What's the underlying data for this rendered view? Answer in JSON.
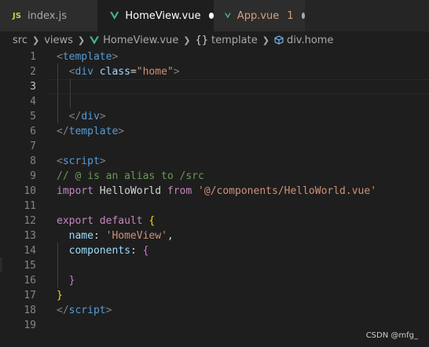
{
  "tabs": [
    {
      "name": "tab-index-js",
      "icon": "js-icon",
      "icon_text": "JS",
      "label": "index.js"
    },
    {
      "name": "tab-homeview-vue",
      "icon": "vue-icon",
      "label": "HomeView.vue",
      "dirty_color": "#ffffff"
    },
    {
      "name": "tab-app-vue",
      "icon": "vue-icon",
      "label": "App.vue",
      "problems": "1",
      "dirty_color": "#a9a9a9"
    }
  ],
  "breadcrumb": {
    "items": [
      "src",
      "views",
      "HomeView.vue",
      "template",
      "div.home"
    ],
    "braces_icon": "{}"
  },
  "colors": {
    "editor_bg": "#1e1e1e",
    "tab_bar_bg": "#252526",
    "vue_green": "#41b883",
    "tag": "#569cd6",
    "attr": "#9cdcfe",
    "string": "#ce9178",
    "comment": "#6a9955",
    "keyword": "#c586c0"
  },
  "active_line": 3,
  "lines": [
    {
      "num": "1",
      "tokens": [
        [
          "<",
          "punc"
        ],
        [
          "template",
          "tag"
        ],
        [
          ">",
          "punc"
        ]
      ]
    },
    {
      "num": "2",
      "tokens": [
        [
          "  ",
          "plain"
        ],
        [
          "<",
          "punc"
        ],
        [
          "div",
          "tag"
        ],
        [
          " ",
          "plain"
        ],
        [
          "class",
          "attr"
        ],
        [
          "=",
          "plain"
        ],
        [
          "\"home\"",
          "str"
        ],
        [
          ">",
          "punc"
        ]
      ]
    },
    {
      "num": "3",
      "tokens": []
    },
    {
      "num": "4",
      "tokens": []
    },
    {
      "num": "5",
      "tokens": [
        [
          "  ",
          "plain"
        ],
        [
          "</",
          "punc"
        ],
        [
          "div",
          "tag"
        ],
        [
          ">",
          "punc"
        ]
      ]
    },
    {
      "num": "6",
      "tokens": [
        [
          "</",
          "punc"
        ],
        [
          "template",
          "tag"
        ],
        [
          ">",
          "punc"
        ]
      ]
    },
    {
      "num": "7",
      "tokens": []
    },
    {
      "num": "8",
      "tokens": [
        [
          "<",
          "punc"
        ],
        [
          "script",
          "tag"
        ],
        [
          ">",
          "punc"
        ]
      ]
    },
    {
      "num": "9",
      "tokens": [
        [
          "// @ is an alias to /src",
          "comment"
        ]
      ]
    },
    {
      "num": "10",
      "tokens": [
        [
          "import",
          "kw"
        ],
        [
          " ",
          "plain"
        ],
        [
          "HelloWorld",
          "plain"
        ],
        [
          " ",
          "plain"
        ],
        [
          "from",
          "kw"
        ],
        [
          " ",
          "plain"
        ],
        [
          "'@/components/HelloWorld.vue'",
          "str"
        ]
      ]
    },
    {
      "num": "11",
      "tokens": []
    },
    {
      "num": "12",
      "tokens": [
        [
          "export",
          "kw"
        ],
        [
          " ",
          "plain"
        ],
        [
          "default",
          "kw"
        ],
        [
          " ",
          "plain"
        ],
        [
          "{",
          "brace1"
        ]
      ]
    },
    {
      "num": "13",
      "tokens": [
        [
          "  ",
          "plain"
        ],
        [
          "name",
          "var"
        ],
        [
          ": ",
          "plain"
        ],
        [
          "'HomeView'",
          "str"
        ],
        [
          ",",
          "plain"
        ]
      ]
    },
    {
      "num": "14",
      "tokens": [
        [
          "  ",
          "plain"
        ],
        [
          "components",
          "var"
        ],
        [
          ": ",
          "plain"
        ],
        [
          "{",
          "brace2"
        ]
      ]
    },
    {
      "num": "15",
      "tokens": []
    },
    {
      "num": "16",
      "tokens": [
        [
          "  ",
          "plain"
        ],
        [
          "}",
          "brace2"
        ]
      ]
    },
    {
      "num": "17",
      "tokens": [
        [
          "}",
          "brace1"
        ]
      ]
    },
    {
      "num": "18",
      "tokens": [
        [
          "</",
          "punc"
        ],
        [
          "script",
          "tag"
        ],
        [
          ">",
          "punc"
        ]
      ]
    },
    {
      "num": "19",
      "tokens": []
    }
  ],
  "watermark": "CSDN @mfg_"
}
